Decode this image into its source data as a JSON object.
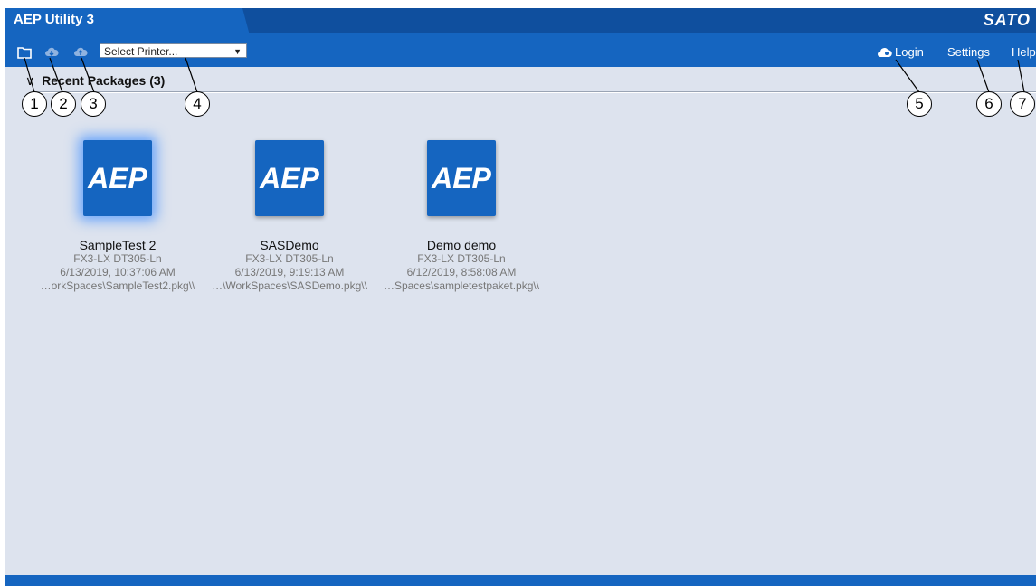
{
  "window": {
    "title": "AEP Utility 3",
    "brand": "SATO"
  },
  "toolbar": {
    "icons": [
      "folder-icon",
      "cloud-download-icon",
      "cloud-upload-icon"
    ],
    "printer_select": {
      "value": "Select Printer...",
      "arrow": "▼"
    },
    "login_label": "Login",
    "settings_label": "Settings",
    "help_label": "Help"
  },
  "section": {
    "chevron": "∨",
    "title": "Recent Packages  (3)"
  },
  "packages": [
    {
      "icon_text": "AEP",
      "name": "SampleTest 2",
      "model": "FX3-LX DT305-Ln",
      "date": "6/13/2019, 10:37:06 AM",
      "path": "…orkSpaces\\SampleTest2.pkg\\\\",
      "selected": true
    },
    {
      "icon_text": "AEP",
      "name": "SASDemo",
      "model": "FX3-LX DT305-Ln",
      "date": "6/13/2019, 9:19:13 AM",
      "path": "…\\WorkSpaces\\SASDemo.pkg\\\\",
      "selected": false
    },
    {
      "icon_text": "AEP",
      "name": "Demo demo",
      "model": "FX3-LX DT305-Ln",
      "date": "6/12/2019, 8:58:08 AM",
      "path": "…Spaces\\sampletestpaket.pkg\\\\",
      "selected": false
    }
  ],
  "callouts": [
    "1",
    "2",
    "3",
    "4",
    "5",
    "6",
    "7"
  ],
  "colors": {
    "titlebar": "#0f4f9e",
    "toolbar": "#1565c0",
    "content_bg": "#dde3ee",
    "tile": "#1565c0"
  }
}
